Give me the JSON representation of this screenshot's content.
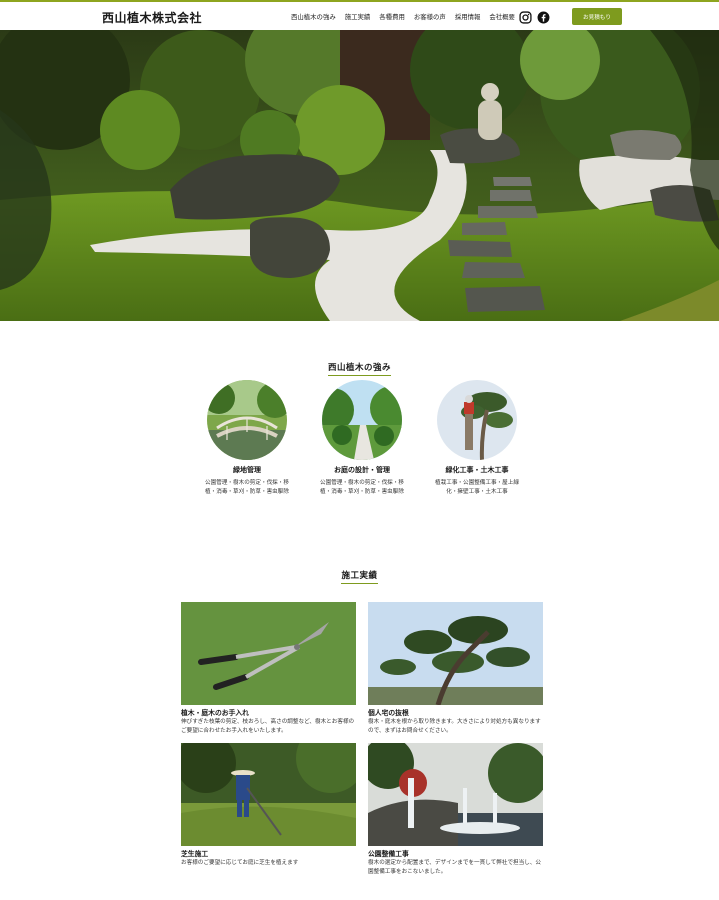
{
  "header": {
    "logo": "西山植木株式会社",
    "nav": [
      "西山植木の強み",
      "施工実績",
      "各種費用",
      "お客様の声",
      "採用情報",
      "会社概要"
    ],
    "cta_label": "お見積もり",
    "accent_color": "#7e9b1e"
  },
  "strengths": {
    "title": "西山植木の強み",
    "items": [
      {
        "title": "緑地管理",
        "text": "公園管理・樹木の剪定・伐採・移植・消毒・草刈・防草・害虫駆除"
      },
      {
        "title": "お庭の設計・管理",
        "text": "公園管理・樹木の剪定・伐採・移植・消毒・草刈・防草・害虫駆除"
      },
      {
        "title": "緑化工事・土木工事",
        "text": "植栽工事・公園整備工事・屋上緑化・擁壁工事・土木工事"
      }
    ]
  },
  "works": {
    "title": "施工実績",
    "items": [
      {
        "title": "植木・庭木のお手入れ",
        "text": "伸びすぎた枝葉の剪定、枝おろし、高さの調整など、樹木とお客様のご要望に合わせたお手入れをいたします。"
      },
      {
        "title": "個人宅の抜根",
        "text": "樹木・庭木を根から取り除きます。大きさにより対処方も異なりますので、まずはお問合せください。"
      },
      {
        "title": "芝生施工",
        "text": "お客様のご要望に応じてお庭に芝生を植えます"
      },
      {
        "title": "公園整備工事",
        "text": "樹木の選定から配置まで、デザインまでを一貫して弊社で担当し、公園整備工事をおこないました。"
      }
    ]
  }
}
